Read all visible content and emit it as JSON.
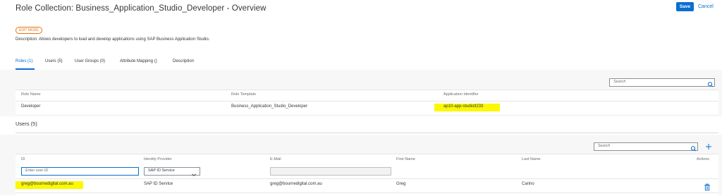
{
  "header": {
    "title": "Role Collection: Business_Application_Studio_Developer - Overview",
    "save_label": "Save",
    "cancel_label": "Cancel",
    "edit_mode_badge": "EDIT MODE",
    "description": "Description: Allows developers to load and develop applications using SAP Business Application Studio."
  },
  "tabs": [
    {
      "label": "Roles (1)",
      "active": true
    },
    {
      "label": "Users (5)",
      "active": false
    },
    {
      "label": "User Groups (0)",
      "active": false
    },
    {
      "label": "Attribute Mapping ()",
      "active": false
    },
    {
      "label": "Description",
      "active": false
    }
  ],
  "roles_table": {
    "search_placeholder": "Search",
    "columns": [
      "Role Name",
      "Role Template",
      "Application Identifier"
    ],
    "rows": [
      {
        "role_name": "Developer",
        "role_template": "Business_Application_Studio_Developer",
        "app_id": "ap10-app-studiolt233"
      }
    ]
  },
  "users_section": {
    "title": "Users (5)",
    "search_placeholder": "Search",
    "add_icon": "plus-icon",
    "columns": [
      "ID",
      "Identity Provider",
      "E-Mail",
      "First Name",
      "Last Name",
      "Actions"
    ],
    "new_row": {
      "id_placeholder": "Enter user ID",
      "identity_provider": "SAP ID Service"
    },
    "rows": [
      {
        "id": "greg@bournedigital.com.au",
        "identity_provider": "SAP ID Service",
        "email": "greg@bournedigital.com.au",
        "first_name": "Greg",
        "last_name": "Carino"
      }
    ]
  },
  "colors": {
    "accent": "#0a6ed1",
    "badge": "#e9730c",
    "highlight": "#fbf802"
  }
}
